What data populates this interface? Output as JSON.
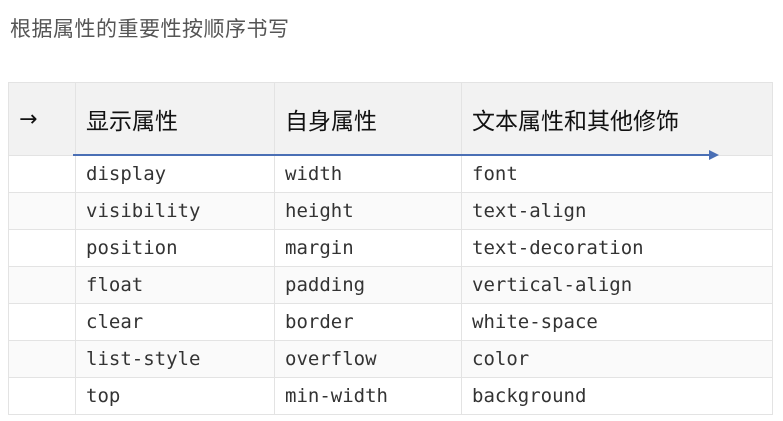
{
  "title": "根据属性的重要性按顺序书写",
  "table": {
    "arrow_symbol": "→",
    "headers": [
      "显示属性",
      "自身属性",
      "文本属性和其他修饰"
    ],
    "rows": [
      [
        "display",
        "width",
        "font"
      ],
      [
        "visibility",
        "height",
        "text-align"
      ],
      [
        "position",
        "margin",
        "text-decoration"
      ],
      [
        "float",
        "padding",
        "vertical-align"
      ],
      [
        "clear",
        "border",
        "white-space"
      ],
      [
        "list-style",
        "overflow",
        "color"
      ],
      [
        "top",
        "min-width",
        "background"
      ]
    ]
  },
  "colors": {
    "arrow_line": "#4a6fb5",
    "header_bg": "#f2f2f2",
    "border": "#e3e3e3"
  }
}
